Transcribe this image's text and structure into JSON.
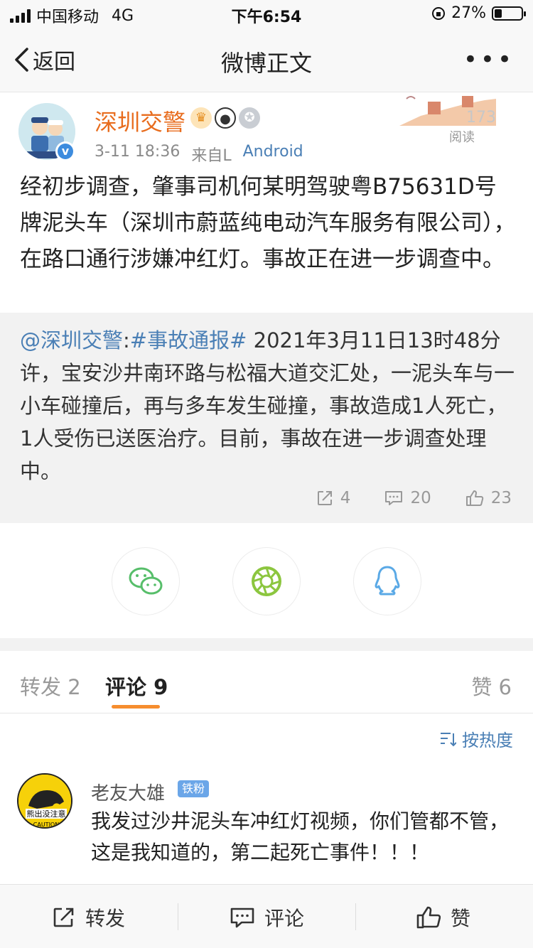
{
  "status_bar": {
    "carrier": "中国移动",
    "network": "4G",
    "time": "下午6:54",
    "battery": "27%",
    "battery_level": 0.27
  },
  "nav": {
    "back_label": "返回",
    "title": "微博正文",
    "more_label": "•••"
  },
  "post": {
    "author": "深圳交警",
    "date": "3-11 18:36",
    "source_prefix": "来自L",
    "source": "Android",
    "read_count": "173",
    "read_label": "阅读",
    "body": "经初步调查，肇事司机何某明驾驶粤B75631D号牌泥头车（深圳市蔚蓝纯电动汽车服务有限公司），在路口通行涉嫌冲红灯。事故正在进一步调查中。"
  },
  "repost": {
    "mention": "@深圳交警",
    "colon": ":",
    "hashtag": "#事故通报#",
    "text": " 2021年3月11日13时48分许，宝安沙井南环路与松福大道交汇处，一泥头车与一小车碰撞后，再与多车发生碰撞，事故造成1人死亡，1人受伤已送医治疗。目前，事故在进一步调查处理中。",
    "reposts": "4",
    "comments": "20",
    "likes": "23"
  },
  "tabs": {
    "repost": "转发 2",
    "comment": "评论 9",
    "like": "赞 6"
  },
  "sort_label": "按热度",
  "comment": {
    "name": "老友大雄",
    "badge": "铁粉",
    "avatar_text": "熊出没注意",
    "avatar_caution": "CAUTION",
    "text": "我发过沙井泥头车冲红灯视频，你们管都不管，这是我知道的，第二起死亡事件！！！"
  },
  "bottom_bar": {
    "repost": "转发",
    "comment": "评论",
    "like": "赞"
  },
  "colors": {
    "accent_orange": "#e86c1d",
    "link_blue": "#4a7fb5",
    "tab_underline": "#f68d2e",
    "wechat_green": "#57be6a"
  }
}
